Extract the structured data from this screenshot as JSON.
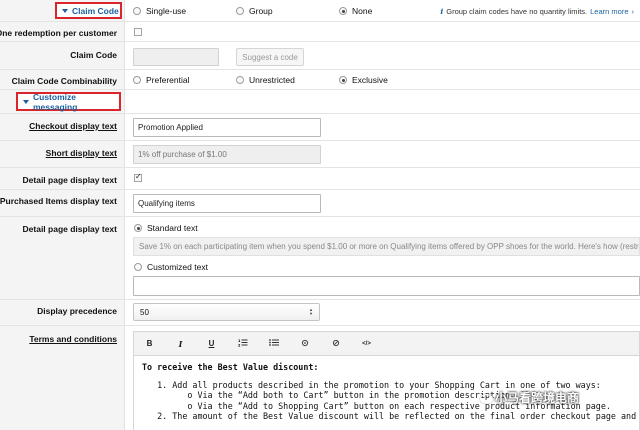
{
  "claim_code_section": {
    "title": "Claim Code",
    "options": [
      "Single-use",
      "Group",
      "None"
    ],
    "selected": "None",
    "info_text": "Group claim codes have no quantity limits.",
    "learn_more": "Learn more"
  },
  "one_redemption": {
    "label": "One redemption per customer",
    "checked": false
  },
  "claim_code_field": {
    "label": "Claim Code",
    "value": "",
    "suggest_button": "Suggest a code"
  },
  "combinability": {
    "label": "Claim Code Combinability",
    "options": [
      "Preferential",
      "Unrestricted",
      "Exclusive"
    ],
    "selected": "Exclusive"
  },
  "customize_section": {
    "title": "Customize messaging"
  },
  "checkout_display": {
    "label": "Checkout display text",
    "value": "Promotion Applied"
  },
  "short_display": {
    "label": "Short display text",
    "value": "1% off purchase of $1.00"
  },
  "detail_page_display": {
    "label": "Detail page display text",
    "checked": true
  },
  "purchased_items": {
    "label": "Purchased Items display text",
    "value": "Qualifying items"
  },
  "detail_page_text": {
    "label": "Detail page display text",
    "standard_label": "Standard text",
    "standard_value": "Save 1% on each participating item when you spend $1.00 or more on Qualifying items offered by OPP shoes for the world. Here's how (restr",
    "custom_label": "Customized text",
    "selected": "Standard text",
    "custom_value": ""
  },
  "display_precedence": {
    "label": "Display precedence",
    "value": "50"
  },
  "terms": {
    "label": "Terms and conditions",
    "toolbar": [
      "B",
      "I",
      "U",
      "ordered-list-icon",
      "unordered-list-icon",
      "link-icon",
      "unlink-icon",
      "source-icon"
    ],
    "line1": "To receive the Best Value discount:",
    "line2": "   1. Add all products described in the promotion to your Shopping Cart in one of two ways:",
    "line3": "         o Via the “Add both to Cart” button in the promotion description, OR",
    "line4": "         o Via the “Add to Shopping Cart” button on each respective product information page.",
    "line5": "   2. The amount of the Best Value discount will be reflected on the final order checkout page and wil"
  },
  "watermark": "小马看跨境电商"
}
